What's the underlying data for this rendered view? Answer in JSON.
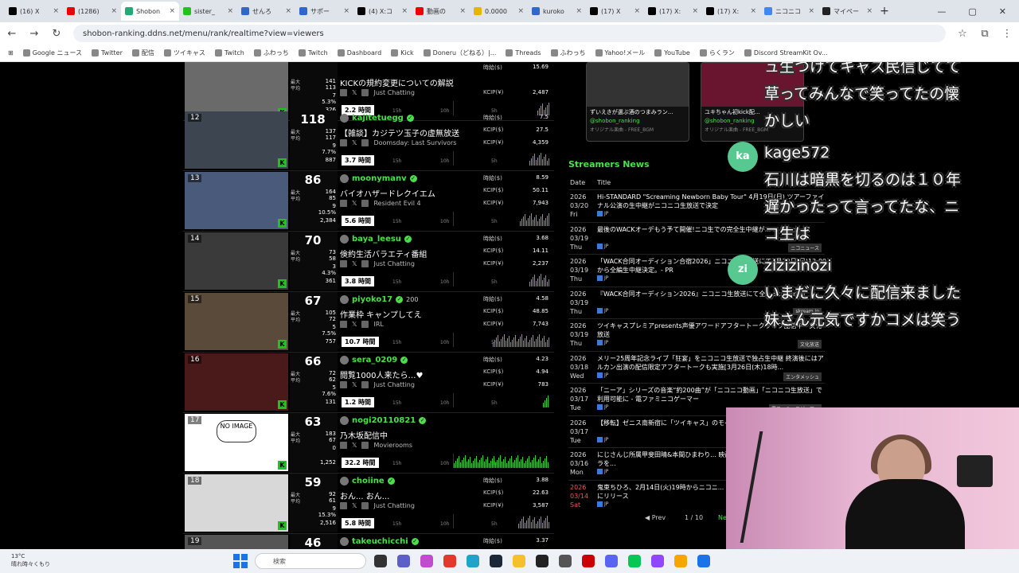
{
  "browser": {
    "tabs": [
      {
        "label": "(16) X",
        "color": "#000"
      },
      {
        "label": "(1286)",
        "color": "#e00"
      },
      {
        "label": "Shobon",
        "color": "#2a7",
        "active": true
      },
      {
        "label": "sister_",
        "color": "#1ec31e"
      },
      {
        "label": "せんろ",
        "color": "#36c"
      },
      {
        "label": "サポー",
        "color": "#36c"
      },
      {
        "label": "(4) X:コ",
        "color": "#000"
      },
      {
        "label": "動画の",
        "color": "#e00"
      },
      {
        "label": "0.0000",
        "color": "#e8b400"
      },
      {
        "label": "kuroko",
        "color": "#36c"
      },
      {
        "label": "(17) X",
        "color": "#000"
      },
      {
        "label": "(17) X:",
        "color": "#000"
      },
      {
        "label": "(17) X:",
        "color": "#000"
      },
      {
        "label": "ニコニコ",
        "color": "#4285f4"
      },
      {
        "label": "マイペー",
        "color": "#222"
      }
    ],
    "url": "shobon-ranking.ddns.net/menu/rank/realtime?view=viewers",
    "bookmarks": [
      "Google ニュース",
      "Twitter",
      "配信",
      "ツイキャス",
      "Twitch",
      "ふわっち",
      "Twitch",
      "Dashboard",
      "Kick",
      "Doneru（どねる）|...",
      "Threads",
      "ふわっち",
      "Yahoo!メール",
      "YouTube",
      "らくラン",
      "Discord StreamKit Ov..."
    ]
  },
  "streams": [
    {
      "rank": "",
      "count": "",
      "name": "",
      "title": "KICKの規約変更についての解説",
      "category": "Just Chatting",
      "duration": "2.2 時間",
      "stats": [
        "141",
        "113",
        "7",
        "5.3%",
        "326"
      ],
      "jikyu": "15.69",
      "kcip": "",
      "kcipy": "2,487"
    },
    {
      "rank": "12",
      "count": "118",
      "name": "kajitetuegg",
      "title": "【雑談】カジテツ玉子の虚無放送",
      "category": "Doomsday: Last Survivors",
      "duration": "3.7 時間",
      "stats": [
        "137",
        "117",
        "9",
        "7.7%",
        "887"
      ],
      "jikyu": "7.5",
      "kcip": "27.5",
      "kcipy": "4,359"
    },
    {
      "rank": "13",
      "count": "86",
      "name": "moonymanv",
      "title": "バイオハザードレクイエム",
      "category": "Resident Evil 4",
      "duration": "5.6 時間",
      "stats": [
        "164",
        "85",
        "9",
        "10.5%",
        "2,384"
      ],
      "jikyu": "8.59",
      "kcip": "50.11",
      "kcipy": "7,943"
    },
    {
      "rank": "14",
      "count": "70",
      "name": "baya_leesu",
      "title": "倹約生活バラエティ番組",
      "category": "Just Chatting",
      "duration": "3.8 時間",
      "stats": [
        "73",
        "58",
        "3",
        "4.3%",
        "361"
      ],
      "jikyu": "3.68",
      "kcip": "14.11",
      "kcipy": "2,237"
    },
    {
      "rank": "15",
      "count": "67",
      "name": "piyoko17",
      "title": "作業枠 キャンプしてえ",
      "category": "IRL",
      "duration": "10.7 時間",
      "stats": [
        "105",
        "72",
        "5",
        "7.5%",
        "757"
      ],
      "jikyu": "4.58",
      "kcip": "48.85",
      "kcipy": "7,743",
      "badge": "200"
    },
    {
      "rank": "16",
      "count": "66",
      "name": "sera_0209",
      "title": "閲覧1000人来たら…♥",
      "category": "Just Chatting",
      "duration": "1.2 時間",
      "stats": [
        "72",
        "62",
        "5",
        "7.6%",
        "131"
      ],
      "jikyu": "4.23",
      "kcip": "4.94",
      "kcipy": "783"
    },
    {
      "rank": "17",
      "count": "63",
      "name": "nogi20110821",
      "title": "乃木坂配信中",
      "category": "Movierooms",
      "duration": "32.2 時間",
      "stats": [
        "183",
        "67",
        "0",
        "",
        "1,252"
      ],
      "jikyu": "",
      "kcip": "",
      "kcipy": ""
    },
    {
      "rank": "18",
      "count": "59",
      "name": "choiine",
      "title": "おん... おん...",
      "category": "Just Chatting",
      "duration": "5.8 時間",
      "stats": [
        "92",
        "61",
        "9",
        "15.3%",
        "2,516"
      ],
      "jikyu": "3.88",
      "kcip": "22.63",
      "kcipy": "3,587"
    },
    {
      "rank": "19",
      "count": "46",
      "name": "takeuchicchi",
      "title": "",
      "category": "",
      "duration": "",
      "stats": [
        "",
        "",
        "",
        "",
        ""
      ],
      "jikyu": "3.37",
      "kcip": "",
      "kcipy": ""
    }
  ],
  "labels": {
    "max": "最大",
    "avg": "平均",
    "jikyu": "時給($)",
    "kcip": "KCIP($)",
    "kcipy": "KCIP(¥)",
    "t15": "15h",
    "t10": "10h",
    "t5": "5h",
    "no_image": "NO IMAGE"
  },
  "tiktok": [
    {
      "caption": "ずいえきが選ぶ酒のつまみラン...",
      "handle": "@shobon_ranking",
      "sound": "オリジナル楽曲 - FREE_BGM",
      "overlay": "TikTokでおもしろい",
      "btn": "今すぐ見る"
    },
    {
      "caption": "ユキちゃん初kick配...",
      "handle": "@shobon_ranking",
      "sound": "オリジナル楽曲 - FREE_BGM",
      "overlay": "",
      "btn": ""
    }
  ],
  "news": {
    "heading": "Streamers News",
    "col_date": "Date",
    "col_title": "Title",
    "items": [
      {
        "date": "2026 03/20 Fri",
        "title": "Hi-STANDARD \"Screaming Newborn Baby Tour\" 4月19日(日) ツアーファイナル公演の生中継がニコニコ生放送で決定",
        "src": "JP",
        "tag": ""
      },
      {
        "date": "2026 03/19 Thu",
        "title": "最後のWACKオーデもう予て開催!ニコ生での完全生中継が... ニコニュース",
        "src": "JP",
        "tag": "ニコニュース"
      },
      {
        "date": "2026 03/19 Thu",
        "title": "「WACK合同オーディション合宿2026」ニコニコ生放送にて3月22日(日)13:00から全編生中継決定。- PR",
        "src": "JP",
        "tag": ""
      },
      {
        "date": "2026 03/19 Thu",
        "title": "『WACK合同オーディション2026』ニコニコ生放送にて全... skream.jp",
        "src": "JP",
        "tag": "skream.jp"
      },
      {
        "date": "2026 03/19 Thu",
        "title": "ツイキャスプレミアpresents声優アワードアフタートークライブ配信中 - 文化放送",
        "src": "JP",
        "tag": "文化放送"
      },
      {
        "date": "2026 03/18 Wed",
        "title": "メリー25周年記念ライブ「狂宴」をニコニコ生放送で独占生中継 終演後にはアルカン出演の配信限定アフタートークも実施[3月26日(木)18時...",
        "src": "JP",
        "tag": "エンタメッシュ"
      },
      {
        "date": "2026 03/17 Tue",
        "title": "「ニーア」シリーズの音楽“約200曲”が「ニコニコ動画」「ニコニコ生放送」で利用可能に - 電ファミニコゲーマー",
        "src": "JP",
        "tag": "電ファミニコゲーマー"
      },
      {
        "date": "2026 03/17 Tue",
        "title": "【移転】ゼニス南新宿に「ツイキャス」のモイ...ケット情報",
        "src": "JP",
        "tag": ""
      },
      {
        "date": "2026 03/16 Mon",
        "title": "にじさんじ所属甲斐田晴&本間ひまわり... 映画実況シリーズ」に出演決定「カメラを...",
        "src": "JP",
        "tag": ""
      },
      {
        "date": "2026 03/14 Sat",
        "title": "鬼束ちひろ、2月14日(火)19時からニコニ... オンエア&ライヴDVDを3月14日にリリース",
        "src": "JP",
        "tag": ""
      }
    ],
    "prev": "◀ Prev",
    "page": "1 / 10",
    "next": "Ne"
  },
  "chat": [
    {
      "user": "",
      "lines": [
        "ュ生つけてキャス民信じてて",
        "草ってみんなで笑ってたの懐",
        "かしい"
      ]
    },
    {
      "user": "kage572",
      "initials": "ka",
      "lines": [
        "石川は暗黒を切るのは１０年",
        "遅かったって言ってたな、ニ",
        "コ生は"
      ]
    },
    {
      "user": "zizizinozi",
      "initials": "zi",
      "lines": [
        "いまだに久々に配信来ました",
        "妹さん元気ですかコメは笑う"
      ]
    }
  ],
  "taskbar": {
    "temp": "13°C",
    "weather": "晴れ時々くもり",
    "search": "検索"
  }
}
